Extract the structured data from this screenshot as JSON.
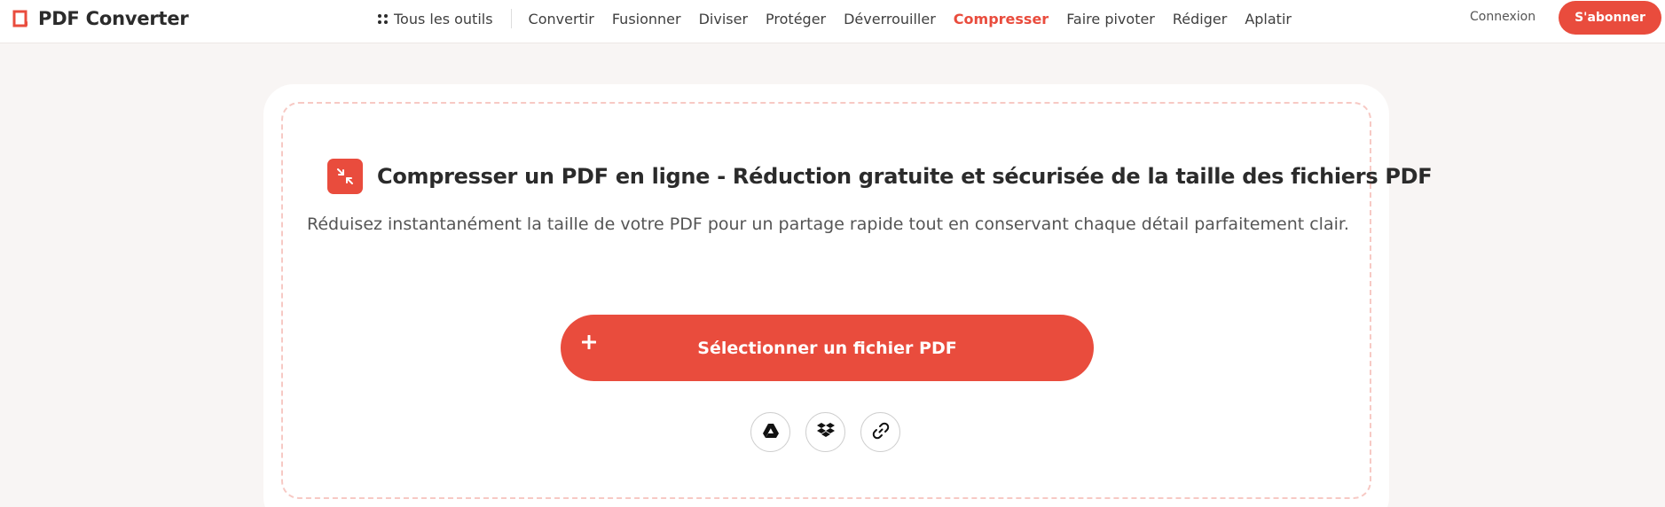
{
  "header": {
    "brand": "PDF Converter",
    "nav_all_tools": "Tous les outils",
    "nav": [
      {
        "label": "Convertir"
      },
      {
        "label": "Fusionner"
      },
      {
        "label": "Diviser"
      },
      {
        "label": "Protéger"
      },
      {
        "label": "Déverrouiller"
      },
      {
        "label": "Compresser",
        "active": true
      },
      {
        "label": "Faire pivoter"
      },
      {
        "label": "Rédiger"
      },
      {
        "label": "Aplatir"
      }
    ],
    "login": "Connexion",
    "subscribe": "S'abonner"
  },
  "main": {
    "title": "Compresser un PDF en ligne - Réduction gratuite et sécurisée de la taille des fichiers PDF",
    "subtitle": "Réduisez instantanément la taille de votre PDF pour un partage rapide tout en conservant chaque détail parfaitement clair.",
    "select_button": "Sélectionner un fichier PDF",
    "sources": [
      "google-drive-icon",
      "dropbox-icon",
      "link-icon"
    ]
  },
  "colors": {
    "accent": "#e94c3d",
    "page_bg": "#f8f5f4",
    "dashed_border": "#f7c9c4"
  }
}
